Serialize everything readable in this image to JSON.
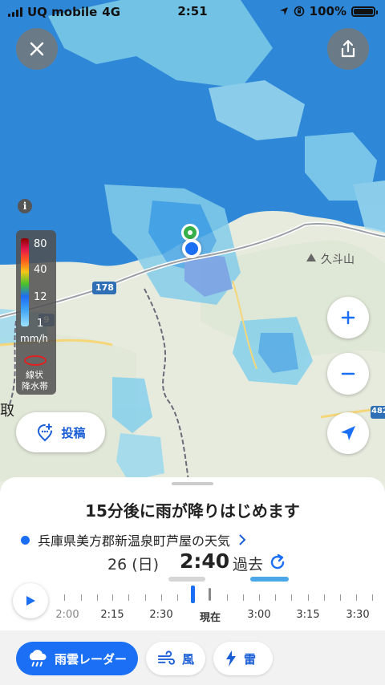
{
  "status_bar": {
    "carrier": "UQ mobile",
    "network": "4G",
    "time": "2:51",
    "battery": "100%"
  },
  "map": {
    "labels": {
      "mountain": "久斗山",
      "route_178": "178",
      "route_9": "9",
      "route_482": "482",
      "edge_text": "取"
    }
  },
  "legend": {
    "values": [
      "80",
      "40",
      "12",
      "1"
    ],
    "unit": "mm/h",
    "band_label_line1": "線状",
    "band_label_line2": "降水帯"
  },
  "post_button": {
    "label": "投稿"
  },
  "sheet": {
    "headline": "15分後に雨が降りはじめます",
    "location": "兵庫県美方郡新温泉町芦屋の天気",
    "date": "26 (日)",
    "time": "2:40",
    "mode": "過去"
  },
  "timeline": {
    "labels": [
      "2:00",
      "2:15",
      "2:30",
      "現在",
      "3:00",
      "3:15",
      "3:30"
    ]
  },
  "nav": {
    "radar": "雨雲レーダー",
    "wind": "風",
    "thunder": "雷"
  },
  "colors": {
    "accent": "#1b6ff5",
    "sea": "#2f87d8",
    "land": "#e9ede1"
  }
}
